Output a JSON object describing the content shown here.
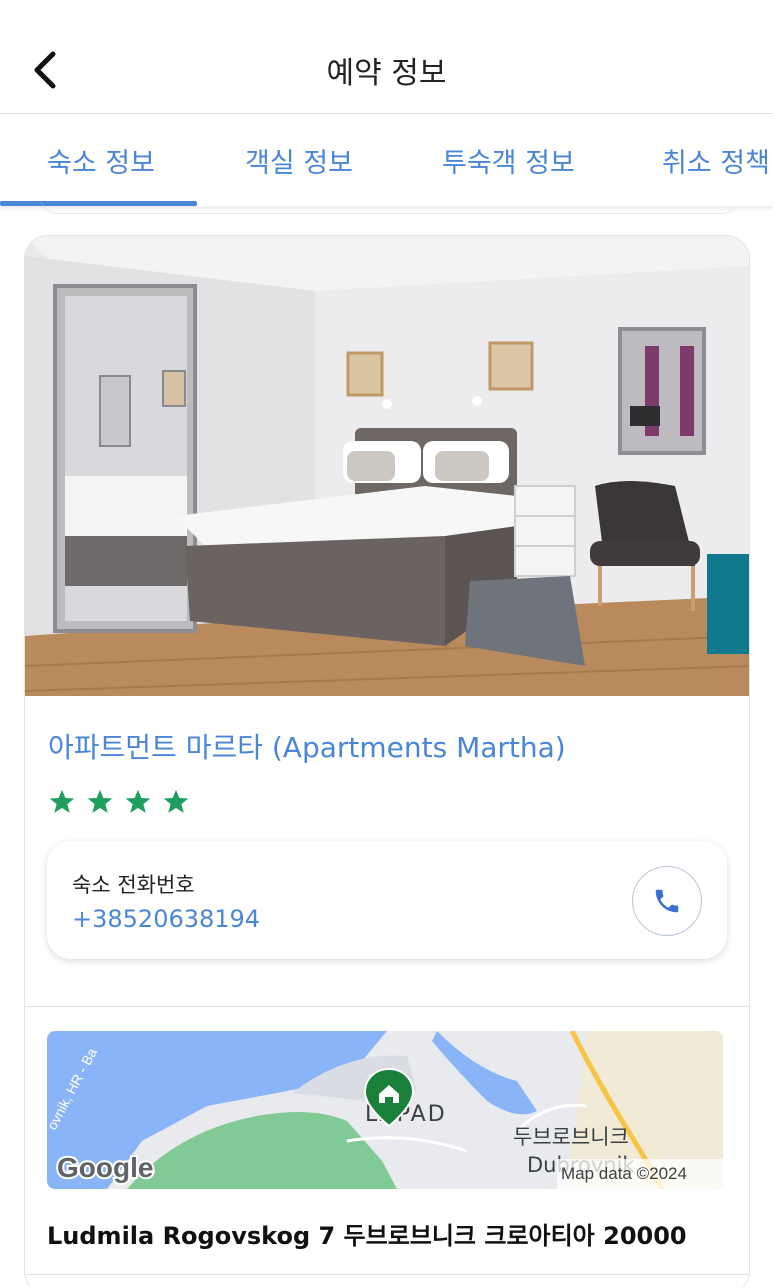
{
  "header": {
    "title": "예약 정보"
  },
  "tabs": [
    {
      "label": "숙소 정보",
      "active": true
    },
    {
      "label": "객실 정보",
      "active": false
    },
    {
      "label": "투숙객 정보",
      "active": false
    },
    {
      "label": "취소 정책",
      "active": false
    }
  ],
  "hotel": {
    "name": "아파트먼트 마르타 (Apartments Martha)",
    "star_rating": 4,
    "phone_label": "숙소 전화번호",
    "phone_number": "+38520638194",
    "address": "Ludmila Rogovskog 7 두브로브니크 크로아티아 20000"
  },
  "map": {
    "district_label": "LAPAD",
    "city_label_ko": "두브로브니크",
    "city_label_en": "Dubrovnik",
    "road_label": "ovnik, HR - Ba",
    "logo_text": "Google",
    "attribution": "Map data ©2024"
  },
  "colors": {
    "accent": "#4a86d8",
    "star": "#1f9e5e",
    "text": "#222222"
  },
  "icons": {
    "back": "chevron-left-icon",
    "star": "star-icon",
    "call": "phone-icon",
    "pin": "home-pin-icon"
  }
}
